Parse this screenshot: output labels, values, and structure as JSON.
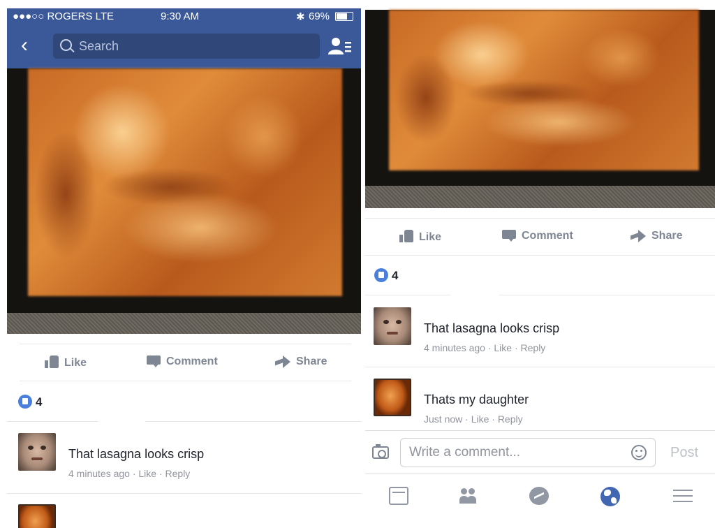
{
  "status_bar": {
    "carrier": "●●●○○ ROGERS  LTE",
    "time": "9:30 AM",
    "battery": "69%"
  },
  "nav": {
    "back_icon": "chevron-left-icon",
    "search_placeholder": "Search",
    "friends_icon": "friend-requests-icon"
  },
  "actions": {
    "like": "Like",
    "comment": "Comment",
    "share": "Share"
  },
  "reactions": {
    "count": "4"
  },
  "comments": [
    {
      "text": "That lasagna looks crisp",
      "meta": "4 minutes ago · Like · Reply",
      "avatar": "face-avatar"
    },
    {
      "text": "Thats my daughter",
      "meta": "Just now · Like · Reply",
      "avatar": "ultrasound-avatar"
    }
  ],
  "composer": {
    "placeholder": "Write a comment...",
    "post_label": "Post"
  },
  "tabbar": {
    "items": [
      "news-feed-icon",
      "friends-icon",
      "messenger-icon",
      "notifications-globe-icon",
      "menu-icon"
    ],
    "active": "notifications-globe-icon"
  },
  "colors": {
    "brand": "#3b5998",
    "like_blue": "#4a7fdc",
    "muted_text": "#90949c"
  }
}
